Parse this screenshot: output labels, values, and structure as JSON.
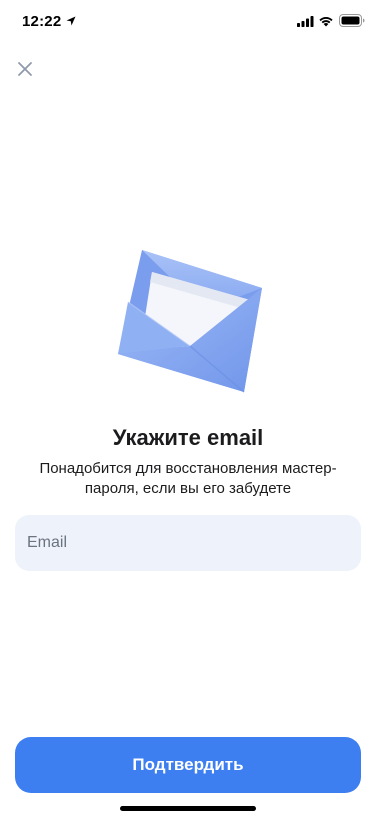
{
  "status_bar": {
    "time": "12:22",
    "icons": [
      "location-arrow-icon",
      "cellular-signal-icon",
      "wifi-icon",
      "battery-icon"
    ]
  },
  "header": {
    "close_icon": "close-icon"
  },
  "illustration": {
    "name": "envelope-illustration",
    "colors": {
      "envelope": "#88aaf2",
      "envelope_dark": "#6f93e8",
      "paper": "#f4f6fb"
    }
  },
  "content": {
    "title": "Укажите email",
    "subtitle_line1": "Понадобится для восстановления мастер-",
    "subtitle_line2": "пароля, если вы его забудете"
  },
  "form": {
    "email": {
      "placeholder": "Email",
      "value": ""
    }
  },
  "actions": {
    "submit_label": "Подтвердить"
  },
  "colors": {
    "accent": "#3d7ff0",
    "field_background": "#eef3fb",
    "text": "#1c1c1e",
    "placeholder": "#6b7280",
    "close_icon": "#8e9aab"
  }
}
